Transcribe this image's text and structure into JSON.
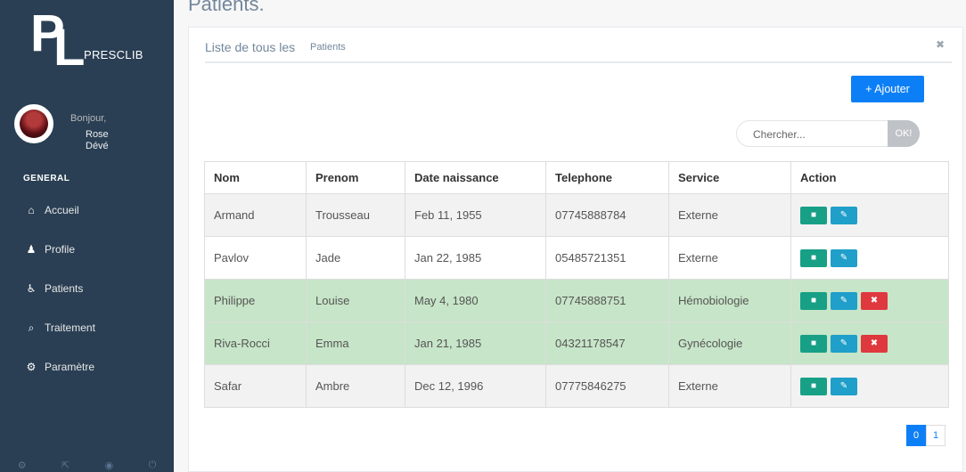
{
  "logo": {
    "letter_p": "P",
    "letter_l": "L",
    "brand": "PRESCLIB"
  },
  "profile": {
    "greeting": "Bonjour,",
    "first_name": "Rose",
    "last_name": "Dévé"
  },
  "sidebar": {
    "section": "GENERAL",
    "items": [
      {
        "label": "Accueil",
        "icon": "home-icon",
        "glyph": "⌂"
      },
      {
        "label": "Profile",
        "icon": "user-icon",
        "glyph": "♟"
      },
      {
        "label": "Patients",
        "icon": "wheelchair-icon",
        "glyph": "♿"
      },
      {
        "label": "Traitement",
        "icon": "search-icon",
        "glyph": "⌕"
      },
      {
        "label": "Paramètre",
        "icon": "gears-icon",
        "glyph": "⚙"
      }
    ]
  },
  "page": {
    "title": "Patients."
  },
  "panel": {
    "title": "Liste de tous les",
    "subtitle": "Patients",
    "close_glyph": "✖",
    "add_button": "+ Ajouter",
    "search_placeholder": "Chercher...",
    "search_button": "OK!"
  },
  "table": {
    "headers": [
      "Nom",
      "Prenom",
      "Date naissance",
      "Telephone",
      "Service",
      "Action"
    ],
    "rows": [
      {
        "nom": "Armand",
        "prenom": "Trousseau",
        "date": "Feb 11, 1955",
        "tel": "07745888784",
        "service": "Externe",
        "deletable": false,
        "style": "odd"
      },
      {
        "nom": "Pavlov",
        "prenom": "Jade",
        "date": "Jan 22, 1985",
        "tel": "05485721351",
        "service": "Externe",
        "deletable": false,
        "style": "even"
      },
      {
        "nom": "Philippe",
        "prenom": "Louise",
        "date": "May 4, 1980",
        "tel": "07745888751",
        "service": "Hémobiologie",
        "deletable": true,
        "style": "green"
      },
      {
        "nom": "Riva-Rocci",
        "prenom": "Emma",
        "date": "Jan 21, 1985",
        "tel": "04321178547",
        "service": "Gynécologie",
        "deletable": true,
        "style": "green"
      },
      {
        "nom": "Safar",
        "prenom": "Ambre",
        "date": "Dec 12, 1996",
        "tel": "07775846275",
        "service": "Externe",
        "deletable": false,
        "style": "odd"
      }
    ]
  },
  "pagination": {
    "pages": [
      "0",
      "1"
    ],
    "active": "0"
  },
  "colors": {
    "sidebar": "#2a3f54",
    "primary": "#0d7ff6",
    "view": "#17a086",
    "edit": "#1f9fc9",
    "delete": "#e0383f",
    "highlight_row": "#c7e5c8"
  }
}
